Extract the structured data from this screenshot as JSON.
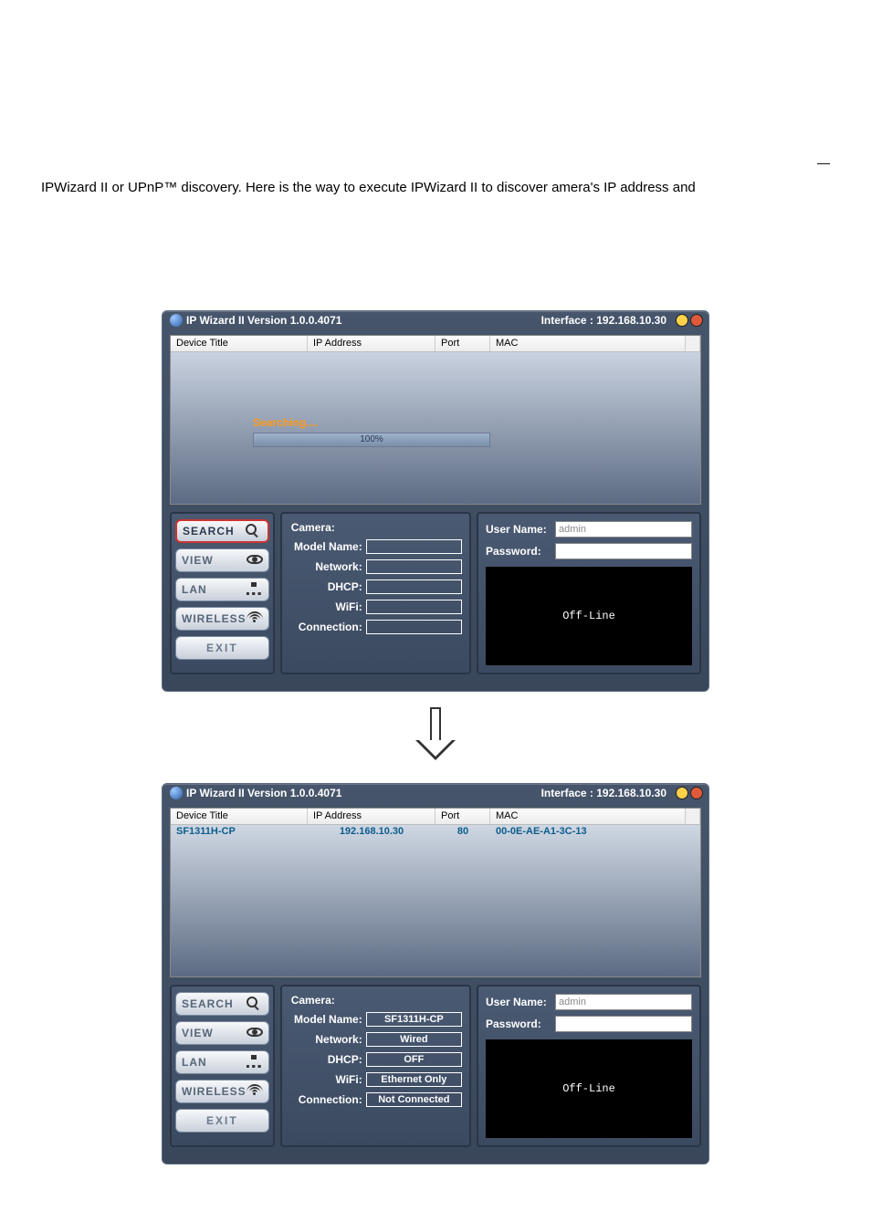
{
  "page": {
    "dash": "—",
    "intro": "IPWizard II or UPnP™ discovery. Here is the way to execute IPWizard II to discover   amera's IP address and"
  },
  "win1": {
    "title": "IP Wizard II  Version 1.0.0.4071",
    "interface_label": "Interface : 192.168.10.30",
    "columns": {
      "title": "Device Title",
      "ip": "IP Address",
      "port": "Port",
      "mac": "MAC"
    },
    "searching": {
      "label": "Searching....",
      "percent": "100%"
    },
    "sidebar": {
      "search": "SEARCH",
      "view": "VIEW",
      "lan": "LAN",
      "wireless": "WIRELESS",
      "exit": "EXIT"
    },
    "info": {
      "camera_label": "Camera:",
      "model_label": "Model Name:",
      "network_label": "Network:",
      "dhcp_label": "DHCP:",
      "wifi_label": "WiFi:",
      "conn_label": "Connection:",
      "model": "",
      "network": "",
      "dhcp": "",
      "wifi": "",
      "conn": ""
    },
    "auth": {
      "user_label": "User Name:",
      "pass_label": "Password:",
      "user_value": "admin",
      "pass_value": ""
    },
    "preview": "Off-Line"
  },
  "win2": {
    "title": "IP Wizard II  Version 1.0.0.4071",
    "interface_label": "Interface : 192.168.10.30",
    "columns": {
      "title": "Device Title",
      "ip": "IP Address",
      "port": "Port",
      "mac": "MAC"
    },
    "row": {
      "title": "SF1311H-CP",
      "ip": "192.168.10.30",
      "port": "80",
      "mac": "00-0E-AE-A1-3C-13"
    },
    "sidebar": {
      "search": "SEARCH",
      "view": "VIEW",
      "lan": "LAN",
      "wireless": "WIRELESS",
      "exit": "EXIT"
    },
    "info": {
      "camera_label": "Camera:",
      "model_label": "Model Name:",
      "network_label": "Network:",
      "dhcp_label": "DHCP:",
      "wifi_label": "WiFi:",
      "conn_label": "Connection:",
      "model": "SF1311H-CP",
      "network": "Wired",
      "dhcp": "OFF",
      "wifi": "Ethernet Only",
      "conn": "Not Connected"
    },
    "auth": {
      "user_label": "User Name:",
      "pass_label": "Password:",
      "user_value": "admin",
      "pass_value": ""
    },
    "preview": "Off-Line"
  }
}
